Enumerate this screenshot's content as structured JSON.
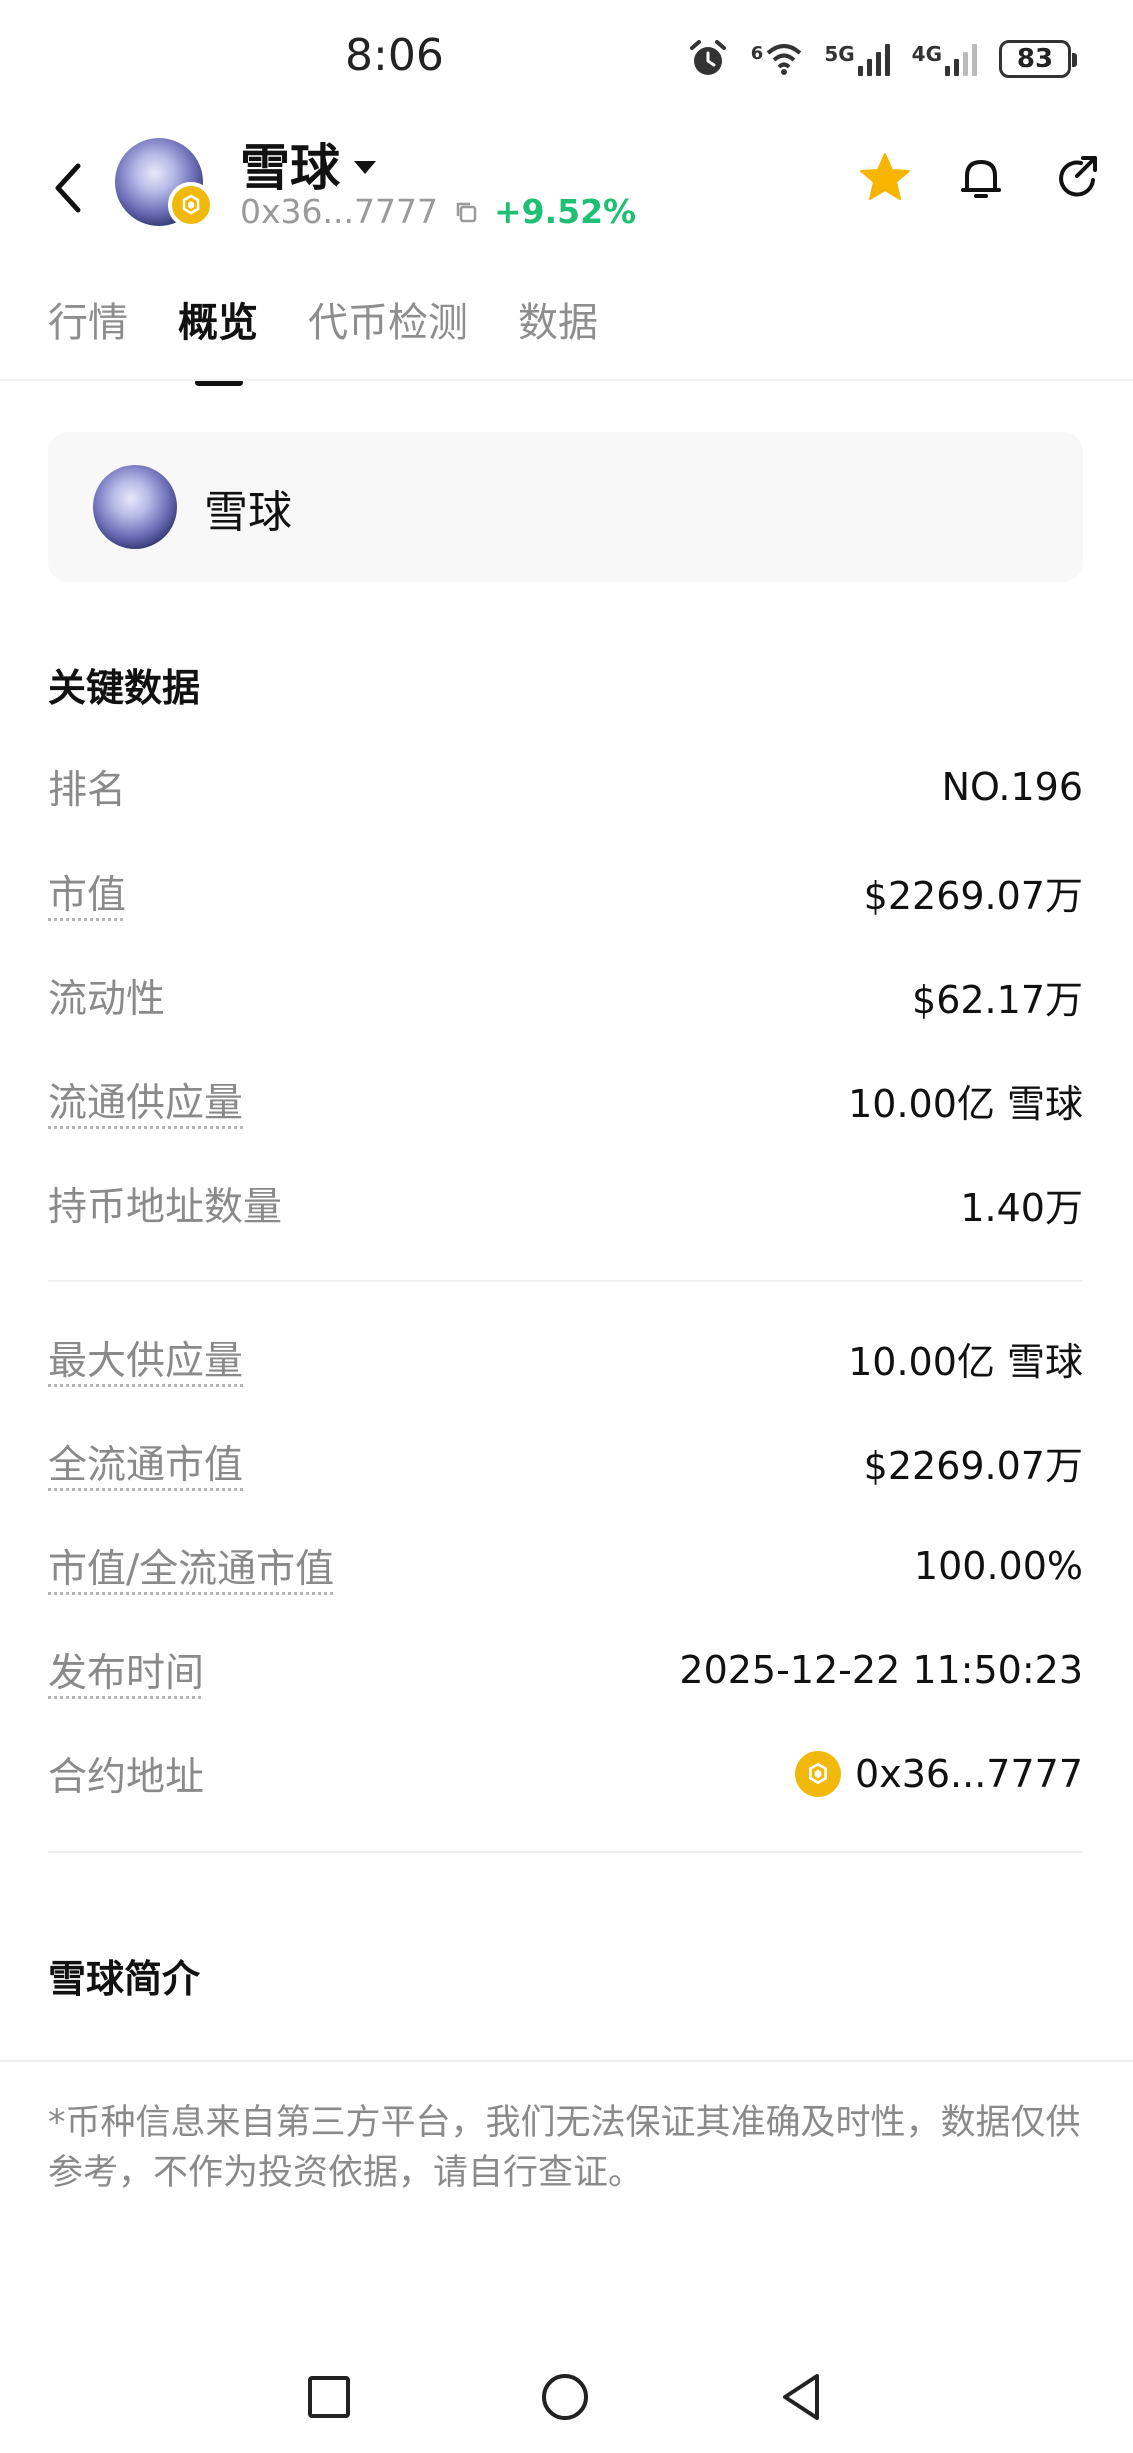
{
  "status_bar": {
    "time": "8:06",
    "net1": "6",
    "net2": "5G",
    "net3": "4G",
    "battery": "83"
  },
  "header": {
    "title": "雪球",
    "address": "0x36...7777",
    "change": "+9.52%"
  },
  "tabs": [
    "行情",
    "概览",
    "代币检测",
    "数据"
  ],
  "token_card": {
    "name": "雪球"
  },
  "key_data": {
    "title": "关键数据",
    "rows": [
      {
        "label": "排名",
        "value": "NO.196"
      },
      {
        "label": "市值",
        "value": "$2269.07万"
      },
      {
        "label": "流动性",
        "value": "$62.17万"
      },
      {
        "label": "流通供应量",
        "value": "10.00亿 雪球"
      },
      {
        "label": "持币地址数量",
        "value": "1.40万"
      }
    ],
    "rows2": [
      {
        "label": "最大供应量",
        "value": "10.00亿 雪球"
      },
      {
        "label": "全流通市值",
        "value": "$2269.07万"
      },
      {
        "label": "市值/全流通市值",
        "value": "100.00%"
      },
      {
        "label": "发布时间",
        "value": "2025-12-22 11:50:23"
      },
      {
        "label": "合约地址",
        "value": "0x36...7777"
      }
    ]
  },
  "intro": {
    "title": "雪球简介"
  },
  "disclaimer": "*币种信息来自第三方平台，我们无法保证其准确及时性，数据仅供参考，不作为投资依据，请自行查证。",
  "colors": {
    "positive": "#1fbf75",
    "star": "#F7B500",
    "chain": "#F0B90B"
  }
}
